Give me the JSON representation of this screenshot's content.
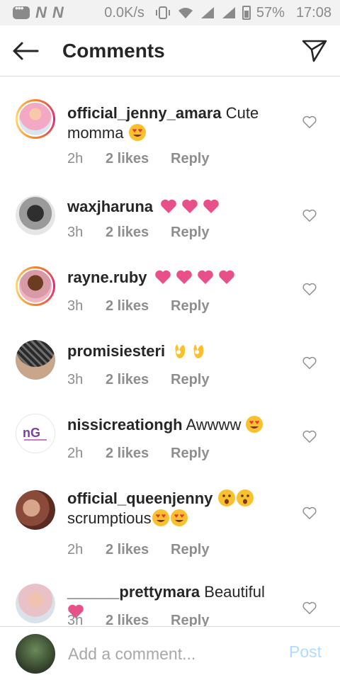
{
  "status_bar": {
    "carrier_letters": [
      "N",
      "N"
    ],
    "speed": "0.0K/s",
    "battery": "57%",
    "time": "17:08"
  },
  "header": {
    "title": "Comments",
    "back_icon": "arrow-left-icon",
    "share_icon": "send-icon"
  },
  "comments": [
    {
      "username": "official_jenny_amara",
      "text": "Cute momma",
      "emojis": [
        "heart-eyes-emoji"
      ],
      "time": "2h",
      "likes": "2 likes",
      "reply": "Reply",
      "story_ring": true,
      "avatar_color": "#f3a9c3"
    },
    {
      "username": "waxjharuna",
      "text": "",
      "emojis": [
        "pink-heart-emoji",
        "pink-heart-emoji",
        "pink-heart-emoji"
      ],
      "time": "3h",
      "likes": "2 likes",
      "reply": "Reply",
      "story_ring": false,
      "avatar_color": "#5a5a5a"
    },
    {
      "username": "rayne.ruby",
      "text": "",
      "emojis": [
        "pink-heart-emoji",
        "pink-heart-emoji",
        "pink-heart-emoji",
        "pink-heart-emoji"
      ],
      "time": "3h",
      "likes": "2 likes",
      "reply": "Reply",
      "story_ring": true,
      "avatar_color": "#8a5a3c"
    },
    {
      "username": "promisiesteri",
      "text": "",
      "emojis": [
        "ok-hand-emoji",
        "ok-hand-emoji"
      ],
      "time": "3h",
      "likes": "2 likes",
      "reply": "Reply",
      "story_ring": false,
      "avatar_color": "#3b3b3b"
    },
    {
      "username": "nissicreationgh",
      "text": "Awwww",
      "emojis": [
        "heart-eyes-emoji"
      ],
      "time": "2h",
      "likes": "2 likes",
      "reply": "Reply",
      "story_ring": false,
      "avatar_color": "#ffffff"
    },
    {
      "username": "official_queenjenny",
      "text": "scrumptious",
      "emojis_before_text": [
        "hushed-face-emoji",
        "hushed-face-emoji"
      ],
      "emojis": [
        "heart-eyes-emoji",
        "heart-eyes-emoji"
      ],
      "time": "2h",
      "likes": "2 likes",
      "reply": "Reply",
      "story_ring": false,
      "avatar_color": "#b8705a"
    },
    {
      "username": "______prettymara",
      "text": "Beautiful",
      "emojis": [
        "pink-heart-emoji"
      ],
      "time": "3h",
      "likes": "2 likes",
      "reply": "Reply",
      "story_ring": false,
      "avatar_color": "#e9c2c8"
    }
  ],
  "composer": {
    "placeholder": "Add a comment...",
    "post_label": "Post",
    "post_color": "#b3dbff"
  },
  "colors": {
    "emoji_heart": "#e8508a",
    "emoji_face": "#fbc02d",
    "meta_text": "#8e8e8e",
    "username_text": "#262626"
  }
}
